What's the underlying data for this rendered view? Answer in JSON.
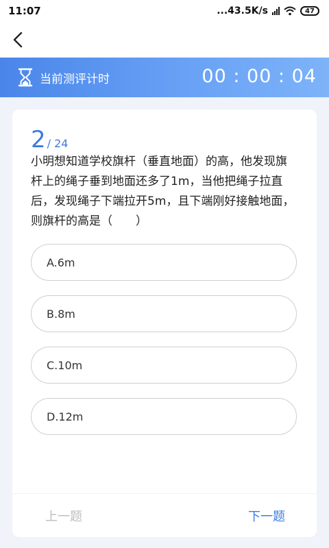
{
  "status_bar": {
    "time": "11:07",
    "network_speed": "...43.5K/s",
    "battery_level": "47"
  },
  "timer": {
    "label": "当前测评计时",
    "value": "00 : 00 : 04"
  },
  "question": {
    "current": "2",
    "total": "/ 24",
    "text": "小明想知道学校旗杆（垂直地面）的高，他发现旗杆上的绳子垂到地面还多了1m，当他把绳子拉直后，发现绳子下端拉开5m，且下端刚好接触地面，则旗杆的高是（　　）",
    "options": [
      {
        "label": "A.6m"
      },
      {
        "label": "B.8m"
      },
      {
        "label": "C.10m"
      },
      {
        "label": "D.12m"
      }
    ]
  },
  "footer": {
    "prev_label": "上一题",
    "next_label": "下一题"
  },
  "colors": {
    "accent": "#3d7be0",
    "timer_gradient_start": "#4a86ea",
    "timer_gradient_end": "#7eb3f8",
    "background": "#f0f3f9"
  },
  "icons": {
    "back": "chevron-left-icon",
    "timer": "hourglass-icon"
  }
}
